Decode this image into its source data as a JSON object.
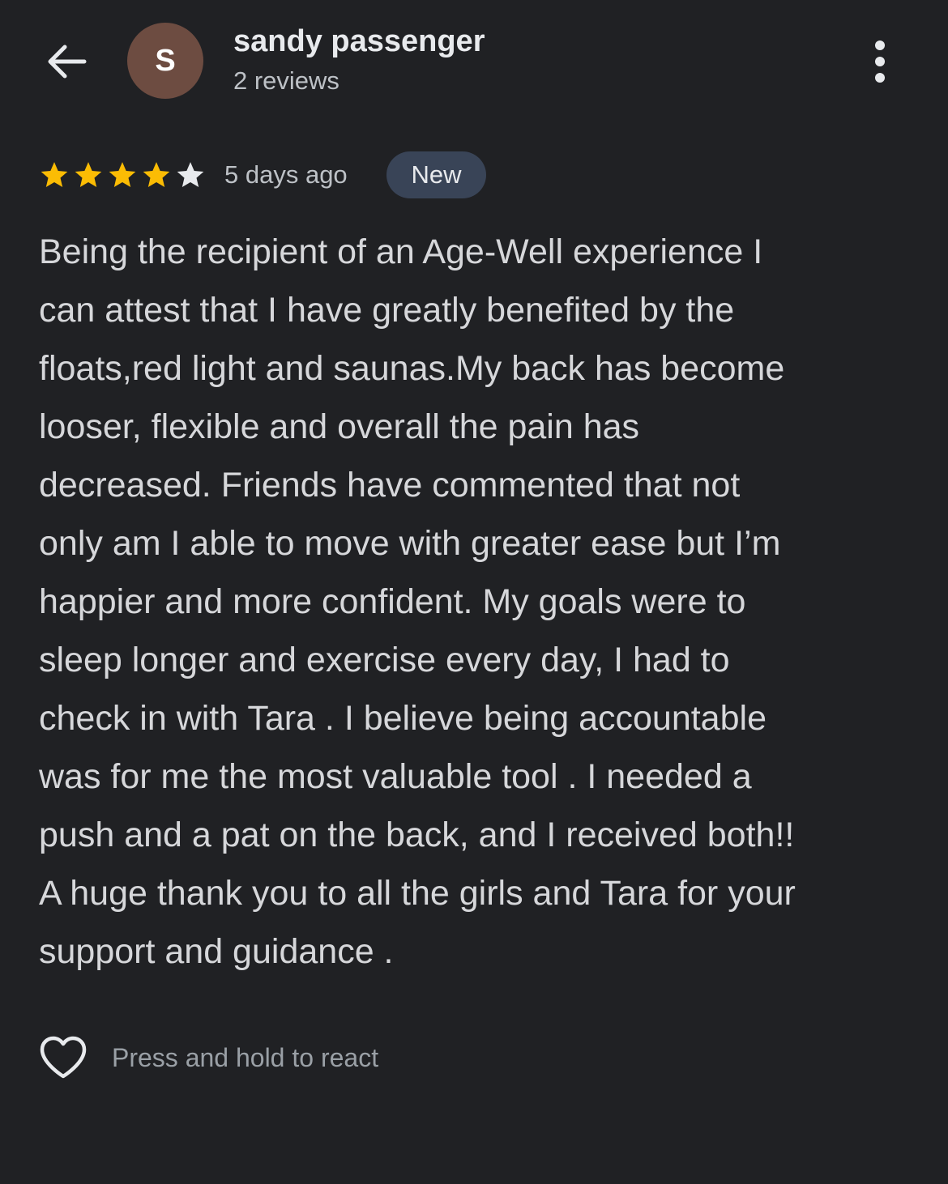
{
  "header": {
    "avatar_letter": "S",
    "avatar_color": "#6d4c41",
    "reviewer_name": "sandy passenger",
    "review_count": "2 reviews",
    "back_icon": "arrow-left-icon",
    "more_icon": "more-vert-icon"
  },
  "review": {
    "rating": 4,
    "max_rating": 5,
    "star_filled_color": "#fbbc04",
    "star_empty_color": "#e8eaed",
    "timestamp": "5 days ago",
    "badge": "New",
    "text_lines": [
      "Being the recipient of an Age-Well experience I",
      "can attest that I have greatly benefited by the",
      "floats,red light and saunas.My back has become",
      "looser, flexible and overall the pain has",
      "decreased. Friends have commented that not",
      "only am I able to move with greater ease but I’m",
      "happier and more confident. My goals were to",
      "sleep longer and exercise every day, I had to",
      "check in with Tara . I believe being accountable",
      "was for me the most valuable tool . I needed a",
      "push and a pat on the back, and I received both!!",
      "A huge thank you to all the girls and Tara for your",
      "support and guidance ."
    ]
  },
  "reactions": {
    "heart_icon": "heart-outline-icon",
    "hint": "Press and hold to react"
  }
}
